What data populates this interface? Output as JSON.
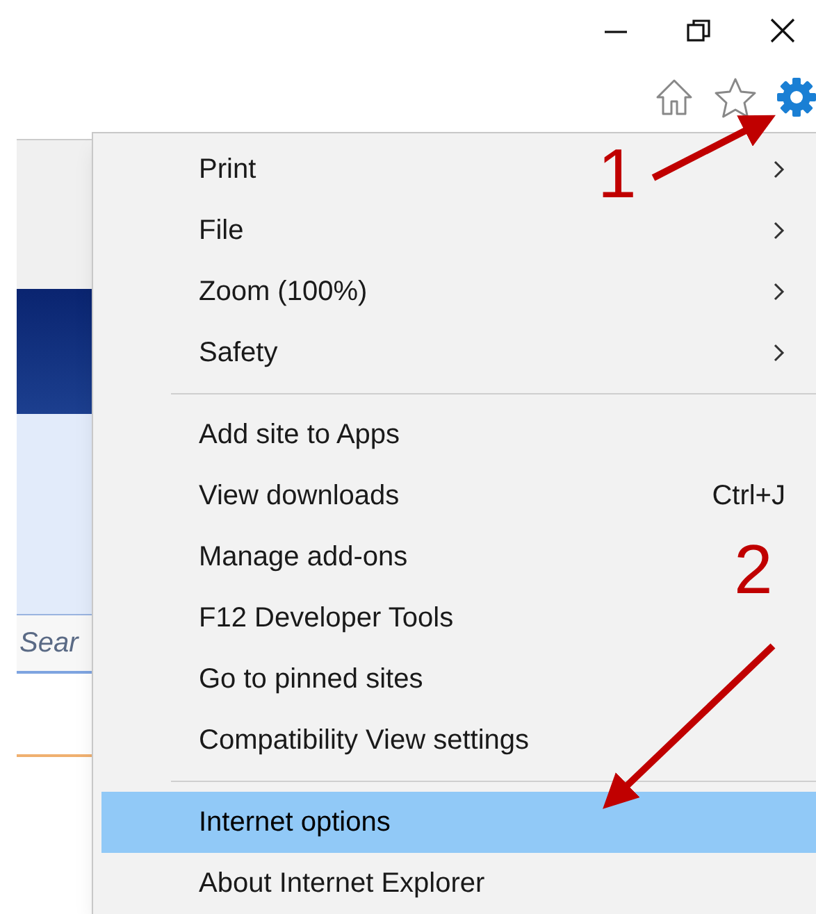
{
  "page": {
    "search_placeholder": "Sear"
  },
  "menu": [
    {
      "kind": "submenu",
      "label": "Print",
      "selected": false
    },
    {
      "kind": "submenu",
      "label": "File",
      "selected": false
    },
    {
      "kind": "submenu",
      "label": "Zoom (100%)",
      "selected": false
    },
    {
      "kind": "submenu",
      "label": "Safety",
      "selected": false
    },
    {
      "kind": "separator"
    },
    {
      "kind": "item",
      "label": "Add site to Apps",
      "selected": false
    },
    {
      "kind": "item",
      "label": "View downloads",
      "shortcut": "Ctrl+J",
      "selected": false
    },
    {
      "kind": "item",
      "label": "Manage add-ons",
      "selected": false
    },
    {
      "kind": "item",
      "label": "F12 Developer Tools",
      "selected": false
    },
    {
      "kind": "item",
      "label": "Go to pinned sites",
      "selected": false
    },
    {
      "kind": "item",
      "label": "Compatibility View settings",
      "selected": false
    },
    {
      "kind": "separator"
    },
    {
      "kind": "item",
      "label": "Internet options",
      "selected": true
    },
    {
      "kind": "item",
      "label": "About Internet Explorer",
      "selected": false
    }
  ],
  "annotations": [
    {
      "label": "1"
    },
    {
      "label": "2"
    }
  ]
}
